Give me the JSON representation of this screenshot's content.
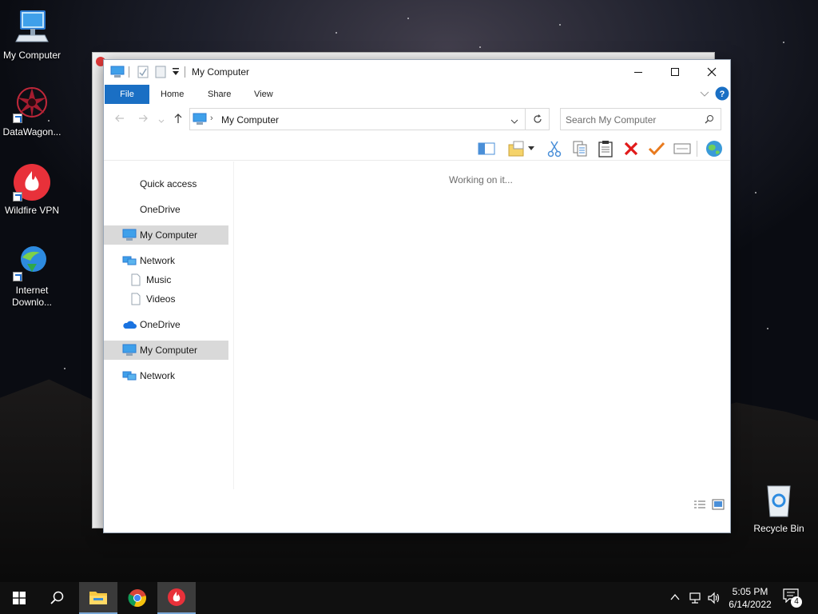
{
  "desktop": {
    "icons": [
      {
        "label": "My Computer"
      },
      {
        "label": "DataWagon..."
      },
      {
        "label": "Wildfire VPN"
      },
      {
        "label": "Internet Downlo..."
      },
      {
        "label": "Recycle Bin"
      }
    ]
  },
  "window": {
    "title": "My Computer",
    "ribbon_tabs": [
      "File",
      "Home",
      "Share",
      "View"
    ],
    "address": {
      "crumb": "My Computer"
    },
    "search": {
      "placeholder": "Search My Computer"
    },
    "status_text": "Working on it...",
    "nav": {
      "items": [
        {
          "label": "Quick access"
        },
        {
          "label": "OneDrive"
        },
        {
          "label": "My Computer"
        },
        {
          "label": "Network"
        },
        {
          "label": "Music"
        },
        {
          "label": "Videos"
        },
        {
          "label": "OneDrive"
        },
        {
          "label": "My Computer"
        },
        {
          "label": "Network"
        }
      ]
    }
  },
  "taskbar": {
    "time": "5:05 PM",
    "date": "6/14/2022",
    "notification_count": "4"
  },
  "colors": {
    "accent": "#1a6fc4",
    "selection": "#d9d9d9",
    "taskbar": "#101010"
  }
}
